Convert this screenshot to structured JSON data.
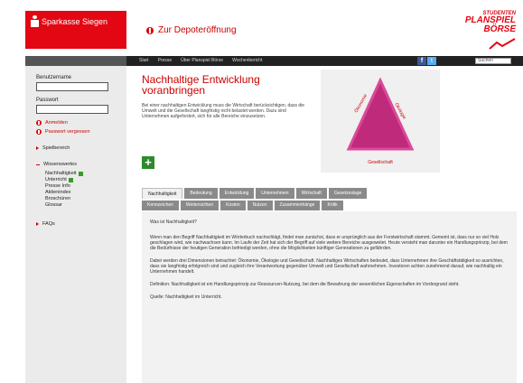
{
  "header": {
    "bank_name": "Sparkasse Siegen",
    "depot_link": "Zur Depoteröffnung",
    "brand_line1": "STUDENTEN",
    "brand_line2": "PLANSPIEL",
    "brand_line3": "BÖRSE"
  },
  "nav": {
    "items": [
      "Start",
      "Presse",
      "Über Planspiel Börse",
      "Wochenbericht"
    ],
    "search_placeholder": "Suchen"
  },
  "sidebar": {
    "user_label": "Benutzername",
    "password_label": "Passwort",
    "login_link": "Anmelden",
    "forgot_link": "Passwort vergessen",
    "section_game": "Spielbereich",
    "section_knowledge": "Wissenswertes",
    "knowledge_items": [
      "Nachhaltigkeit",
      "Unterricht",
      "Presse Info",
      "Aktienindex",
      "Broschüren",
      "Glossar"
    ],
    "section_faq": "FAQs"
  },
  "hero": {
    "title": "Nachhaltige Entwicklung voranbringen",
    "text": "Bei einer nachhaltigen Entwicklung muss die Wirtschaft berücksichtigen, dass die Umwelt und die Gesellschaft langfristig nicht belastet werden. Dazu sind Unternehmen aufgefordert, sich für alle Bereiche einzusetzen.",
    "triangle_left": "Ökonomie",
    "triangle_right": "Ökologie",
    "triangle_bottom": "Gesellschaft"
  },
  "tabs_row1": [
    "Nachhaltigkeit",
    "Bedeutung",
    "Entwicklung",
    "Unternehmen",
    "Wirtschaft",
    "Gesetzeslage"
  ],
  "tabs_row2": [
    "Kennzeichen",
    "Weitersichten",
    "Kosten",
    "Nutzen",
    "Zusammenhänge",
    "Kritik"
  ],
  "content": {
    "question": "Was ist Nachhaltigkeit?",
    "paragraph1": "Wenn man den Begriff Nachhaltigkeit im Wörterbuch nachschlägt, findet man zunächst, dass er ursprünglich aus der Forstwirtschaft stammt. Gemeint ist, dass nur so viel Holz geschlagen wird, wie nachwachsen kann. Im Laufe der Zeit hat sich der Begriff auf viele weitere Bereiche ausgeweitet. Heute versteht man darunter ein Handlungsprinzip, bei dem die Bedürfnisse der heutigen Generation befriedigt werden, ohne die Möglichkeiten künftiger Generationen zu gefährden.",
    "paragraph2": "Dabei werden drei Dimensionen betrachtet: Ökonomie, Ökologie und Gesellschaft. Nachhaltiges Wirtschaften bedeutet, dass Unternehmen ihre Geschäftstätigkeit so ausrichten, dass sie langfristig erfolgreich sind und zugleich ihre Verantwortung gegenüber Umwelt und Gesellschaft wahrnehmen. Investoren achten zunehmend darauf, wie nachhaltig ein Unternehmen handelt.",
    "paragraph3": "Definition: Nachhaltigkeit ist ein Handlungsprinzip zur Ressourcen-Nutzung, bei dem die Bewahrung der wesentlichen Eigenschaften im Vordergrund steht.",
    "paragraph4": "Quelle: Nachhaltigkeit im Unterricht."
  }
}
